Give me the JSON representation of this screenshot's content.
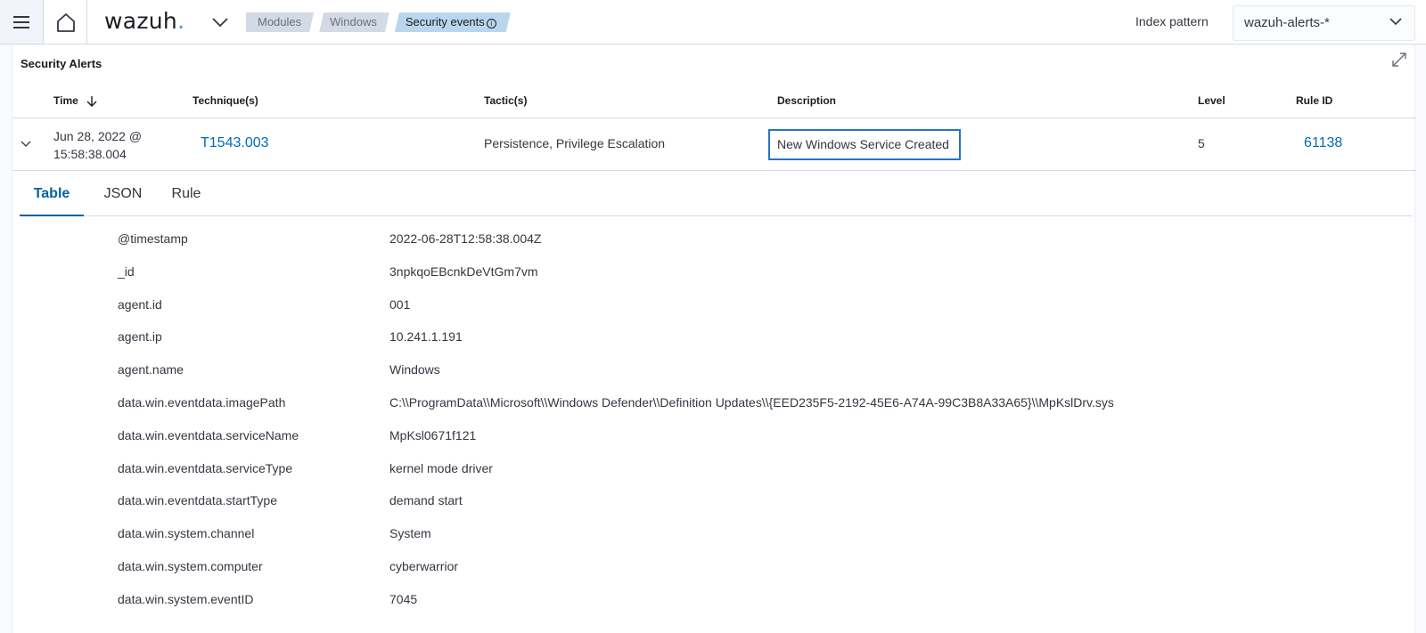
{
  "header": {
    "logo_text": "wazuh",
    "logo_dot": ".",
    "breadcrumbs": [
      "Modules",
      "Windows",
      "Security events"
    ],
    "breadcrumb_info_glyph": "i",
    "index_pattern_label": "Index pattern",
    "index_pattern_value": "wazuh-alerts-*",
    "icons": [
      "menu-icon",
      "home-icon",
      "chevron-down-icon",
      "info-icon"
    ]
  },
  "panel": {
    "title": "Security Alerts",
    "columns": {
      "time": "Time",
      "techniques": "Technique(s)",
      "tactics": "Tactic(s)",
      "description": "Description",
      "level": "Level",
      "rule_id": "Rule ID"
    },
    "row": {
      "time_line1": "Jun 28, 2022 @",
      "time_line2": "15:58:38.004",
      "technique": "T1543.003",
      "tactics": "Persistence, Privilege Escalation",
      "description": "New Windows Service Created",
      "level": "5",
      "rule_id": "61138"
    },
    "tabs": [
      "Table",
      "JSON",
      "Rule"
    ],
    "active_tab": "Table",
    "details": [
      {
        "key": "@timestamp",
        "value": "2022-06-28T12:58:38.004Z"
      },
      {
        "key": "_id",
        "value": "3npkqoEBcnkDeVtGm7vm"
      },
      {
        "key": "agent.id",
        "value": "001"
      },
      {
        "key": "agent.ip",
        "value": "10.241.1.191"
      },
      {
        "key": "agent.name",
        "value": "Windows"
      },
      {
        "key": "data.win.eventdata.imagePath",
        "value": "C:\\\\ProgramData\\\\Microsoft\\\\Windows Defender\\\\Definition Updates\\\\{EED235F5-2192-45E6-A74A-99C3B8A33A65}\\\\MpKslDrv.sys"
      },
      {
        "key": "data.win.eventdata.serviceName",
        "value": "MpKsl0671f121"
      },
      {
        "key": "data.win.eventdata.serviceType",
        "value": "kernel mode driver"
      },
      {
        "key": "data.win.eventdata.startType",
        "value": "demand start"
      },
      {
        "key": "data.win.system.channel",
        "value": "System"
      },
      {
        "key": "data.win.system.computer",
        "value": "cyberwarrior"
      },
      {
        "key": "data.win.system.eventID",
        "value": "7045"
      }
    ]
  },
  "colors": {
    "link": "#006bb4",
    "active_tab": "#0061a6",
    "highlight_border": "#2574c8",
    "breadcrumb_active": "#b9d6ec",
    "breadcrumb": "#d3dae6"
  }
}
